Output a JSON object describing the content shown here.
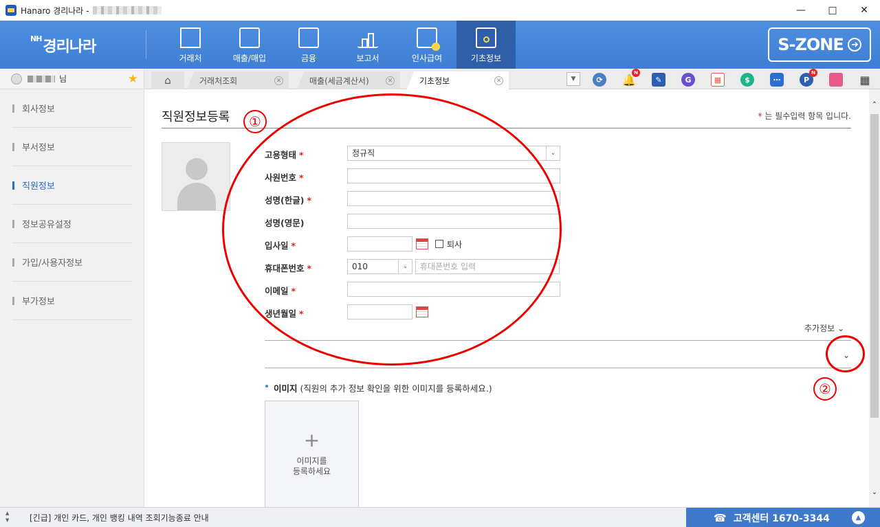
{
  "window": {
    "title": "Hanaro 경리나라 -"
  },
  "brand": {
    "logo_prefix": "NH",
    "logo_text": "경리나라",
    "szone_label": "S-ZONE"
  },
  "nav": {
    "items": [
      {
        "label": "거래처"
      },
      {
        "label": "매출/매입"
      },
      {
        "label": "금융"
      },
      {
        "label": "보고서"
      },
      {
        "label": "인사급여"
      },
      {
        "label": "기초정보"
      }
    ]
  },
  "user": {
    "suffix": "님"
  },
  "tabs": [
    {
      "label": "거래처조회"
    },
    {
      "label": "매출(세금계산서)"
    },
    {
      "label": "기초정보"
    }
  ],
  "toolbar": {
    "badge_new": "N"
  },
  "sidebar": {
    "items": [
      {
        "label": "회사정보"
      },
      {
        "label": "부서정보"
      },
      {
        "label": "직원정보"
      },
      {
        "label": "정보공유설정"
      },
      {
        "label": "가입/사용자정보"
      },
      {
        "label": "부가정보"
      }
    ]
  },
  "page": {
    "title": "직원정보등록",
    "required_star": "*",
    "required_note": "는 필수입력 항목 입니다."
  },
  "form": {
    "employment_type": {
      "label": "고용형태",
      "value": "정규직"
    },
    "employee_no": {
      "label": "사원번호"
    },
    "name_kr": {
      "label": "성명(한글)"
    },
    "name_en": {
      "label": "성명(영문)"
    },
    "hire_date": {
      "label": "입사일",
      "resign_label": "퇴사"
    },
    "mobile": {
      "label": "휴대폰번호",
      "prefix": "010",
      "placeholder": "휴대폰번호 입력"
    },
    "email": {
      "label": "이메일"
    },
    "birth_date": {
      "label": "생년월일"
    },
    "more_label": "추가정보"
  },
  "image_section": {
    "title": "이미지",
    "desc": "(직원의 추가 정보 확인을 위한 이미지를 등록하세요.)",
    "plus": "+",
    "upload_line1": "이미지를",
    "upload_line2": "등록하세요"
  },
  "annotations": {
    "marker1": "①",
    "marker2": "②",
    "color": "#e00000"
  },
  "footer": {
    "notice": "[긴급] 개인 카드, 개인 뱅킹 내역 조회기능종료 안내",
    "support": "고객센터 1670-3344"
  },
  "colors": {
    "nav_bg": "#3f7fd4",
    "nav_active": "#2f5fa8",
    "accent": "#2a6bc4",
    "required": "#dd2222"
  }
}
